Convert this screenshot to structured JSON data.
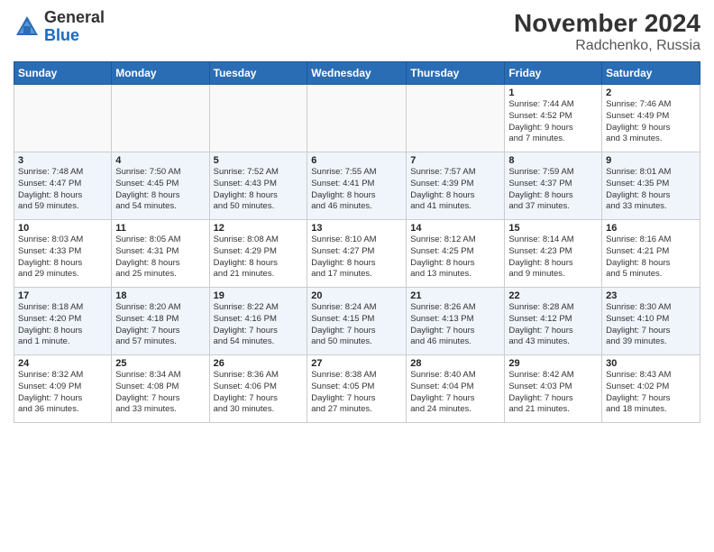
{
  "header": {
    "logo_general": "General",
    "logo_blue": "Blue",
    "month_title": "November 2024",
    "location": "Radchenko, Russia"
  },
  "weekdays": [
    "Sunday",
    "Monday",
    "Tuesday",
    "Wednesday",
    "Thursday",
    "Friday",
    "Saturday"
  ],
  "weeks": [
    [
      {
        "day": "",
        "info": ""
      },
      {
        "day": "",
        "info": ""
      },
      {
        "day": "",
        "info": ""
      },
      {
        "day": "",
        "info": ""
      },
      {
        "day": "",
        "info": ""
      },
      {
        "day": "1",
        "info": "Sunrise: 7:44 AM\nSunset: 4:52 PM\nDaylight: 9 hours\nand 7 minutes."
      },
      {
        "day": "2",
        "info": "Sunrise: 7:46 AM\nSunset: 4:49 PM\nDaylight: 9 hours\nand 3 minutes."
      }
    ],
    [
      {
        "day": "3",
        "info": "Sunrise: 7:48 AM\nSunset: 4:47 PM\nDaylight: 8 hours\nand 59 minutes."
      },
      {
        "day": "4",
        "info": "Sunrise: 7:50 AM\nSunset: 4:45 PM\nDaylight: 8 hours\nand 54 minutes."
      },
      {
        "day": "5",
        "info": "Sunrise: 7:52 AM\nSunset: 4:43 PM\nDaylight: 8 hours\nand 50 minutes."
      },
      {
        "day": "6",
        "info": "Sunrise: 7:55 AM\nSunset: 4:41 PM\nDaylight: 8 hours\nand 46 minutes."
      },
      {
        "day": "7",
        "info": "Sunrise: 7:57 AM\nSunset: 4:39 PM\nDaylight: 8 hours\nand 41 minutes."
      },
      {
        "day": "8",
        "info": "Sunrise: 7:59 AM\nSunset: 4:37 PM\nDaylight: 8 hours\nand 37 minutes."
      },
      {
        "day": "9",
        "info": "Sunrise: 8:01 AM\nSunset: 4:35 PM\nDaylight: 8 hours\nand 33 minutes."
      }
    ],
    [
      {
        "day": "10",
        "info": "Sunrise: 8:03 AM\nSunset: 4:33 PM\nDaylight: 8 hours\nand 29 minutes."
      },
      {
        "day": "11",
        "info": "Sunrise: 8:05 AM\nSunset: 4:31 PM\nDaylight: 8 hours\nand 25 minutes."
      },
      {
        "day": "12",
        "info": "Sunrise: 8:08 AM\nSunset: 4:29 PM\nDaylight: 8 hours\nand 21 minutes."
      },
      {
        "day": "13",
        "info": "Sunrise: 8:10 AM\nSunset: 4:27 PM\nDaylight: 8 hours\nand 17 minutes."
      },
      {
        "day": "14",
        "info": "Sunrise: 8:12 AM\nSunset: 4:25 PM\nDaylight: 8 hours\nand 13 minutes."
      },
      {
        "day": "15",
        "info": "Sunrise: 8:14 AM\nSunset: 4:23 PM\nDaylight: 8 hours\nand 9 minutes."
      },
      {
        "day": "16",
        "info": "Sunrise: 8:16 AM\nSunset: 4:21 PM\nDaylight: 8 hours\nand 5 minutes."
      }
    ],
    [
      {
        "day": "17",
        "info": "Sunrise: 8:18 AM\nSunset: 4:20 PM\nDaylight: 8 hours\nand 1 minute."
      },
      {
        "day": "18",
        "info": "Sunrise: 8:20 AM\nSunset: 4:18 PM\nDaylight: 7 hours\nand 57 minutes."
      },
      {
        "day": "19",
        "info": "Sunrise: 8:22 AM\nSunset: 4:16 PM\nDaylight: 7 hours\nand 54 minutes."
      },
      {
        "day": "20",
        "info": "Sunrise: 8:24 AM\nSunset: 4:15 PM\nDaylight: 7 hours\nand 50 minutes."
      },
      {
        "day": "21",
        "info": "Sunrise: 8:26 AM\nSunset: 4:13 PM\nDaylight: 7 hours\nand 46 minutes."
      },
      {
        "day": "22",
        "info": "Sunrise: 8:28 AM\nSunset: 4:12 PM\nDaylight: 7 hours\nand 43 minutes."
      },
      {
        "day": "23",
        "info": "Sunrise: 8:30 AM\nSunset: 4:10 PM\nDaylight: 7 hours\nand 39 minutes."
      }
    ],
    [
      {
        "day": "24",
        "info": "Sunrise: 8:32 AM\nSunset: 4:09 PM\nDaylight: 7 hours\nand 36 minutes."
      },
      {
        "day": "25",
        "info": "Sunrise: 8:34 AM\nSunset: 4:08 PM\nDaylight: 7 hours\nand 33 minutes."
      },
      {
        "day": "26",
        "info": "Sunrise: 8:36 AM\nSunset: 4:06 PM\nDaylight: 7 hours\nand 30 minutes."
      },
      {
        "day": "27",
        "info": "Sunrise: 8:38 AM\nSunset: 4:05 PM\nDaylight: 7 hours\nand 27 minutes."
      },
      {
        "day": "28",
        "info": "Sunrise: 8:40 AM\nSunset: 4:04 PM\nDaylight: 7 hours\nand 24 minutes."
      },
      {
        "day": "29",
        "info": "Sunrise: 8:42 AM\nSunset: 4:03 PM\nDaylight: 7 hours\nand 21 minutes."
      },
      {
        "day": "30",
        "info": "Sunrise: 8:43 AM\nSunset: 4:02 PM\nDaylight: 7 hours\nand 18 minutes."
      }
    ]
  ]
}
